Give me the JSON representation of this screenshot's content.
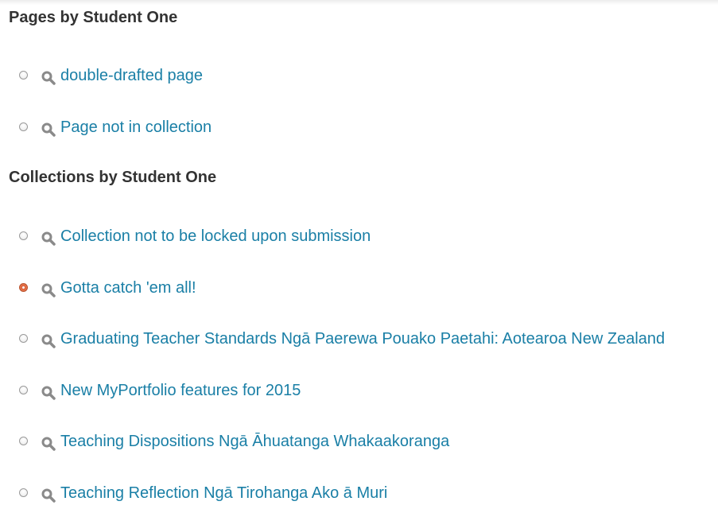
{
  "pages_section": {
    "heading": "Pages by Student One",
    "items": [
      {
        "label": "double-drafted page",
        "selected": false
      },
      {
        "label": "Page not in collection",
        "selected": false
      }
    ]
  },
  "collections_section": {
    "heading": "Collections by Student One",
    "items": [
      {
        "label": "Collection not to be locked upon submission",
        "selected": false
      },
      {
        "label": "Gotta catch 'em all!",
        "selected": true
      },
      {
        "label": "Graduating Teacher Standards Ngā Paerewa Pouako Paetahi: Aotearoa New Zealand",
        "selected": false
      },
      {
        "label": "New MyPortfolio features for 2015",
        "selected": false
      },
      {
        "label": "Teaching Dispositions Ngā Āhuatanga Whakaakoranga",
        "selected": false
      },
      {
        "label": "Teaching Reflection Ngā Tirohanga Ako ā Muri",
        "selected": false
      }
    ]
  },
  "icons": {
    "preview": "magnifier-icon",
    "radio": "radio-button"
  },
  "colors": {
    "link": "#1a7fa6",
    "heading": "#333333",
    "radio_selected": "#e8734a",
    "icon": "#8a8a8a"
  }
}
